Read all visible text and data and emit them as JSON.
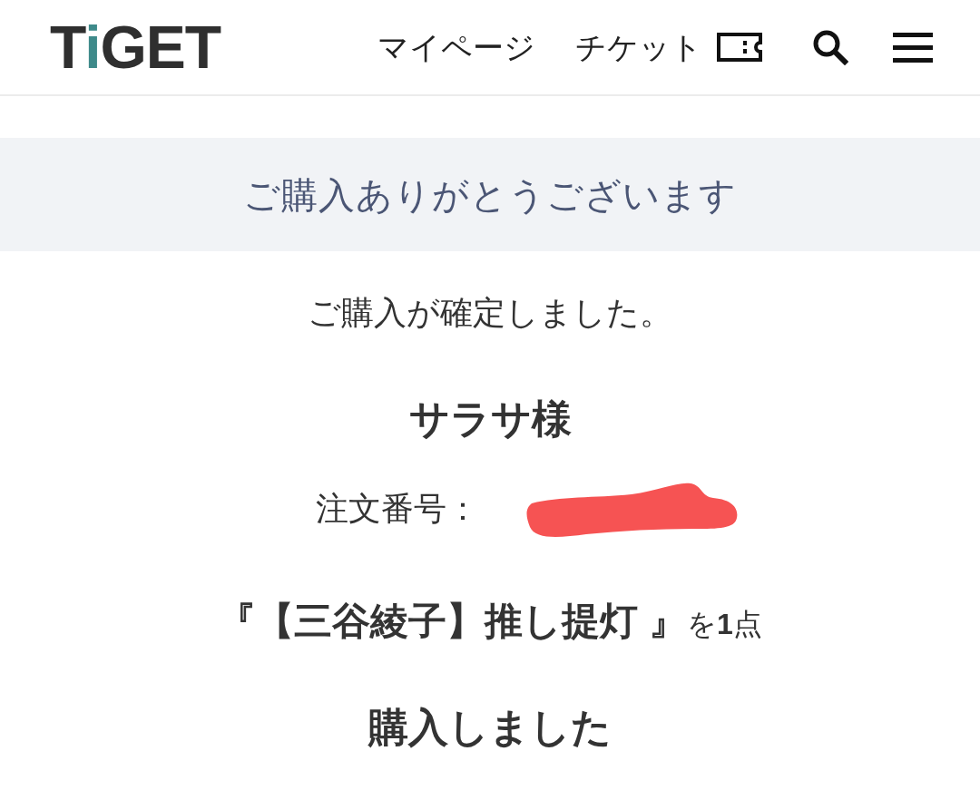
{
  "header": {
    "logo": "TiGET",
    "nav": [
      {
        "label": "マイページ",
        "kind": "link"
      },
      {
        "label": "チケット",
        "kind": "ticket"
      }
    ]
  },
  "banner": {
    "title": "ご購入ありがとうございます"
  },
  "message": "ご購入が確定しました。",
  "customer_name": "サラサ様",
  "order": {
    "label": "注文番号：",
    "redacted": true
  },
  "purchase_line": "**『【三谷綾子】推し提灯 』**を**1**点",
  "closing": "購入しました"
}
